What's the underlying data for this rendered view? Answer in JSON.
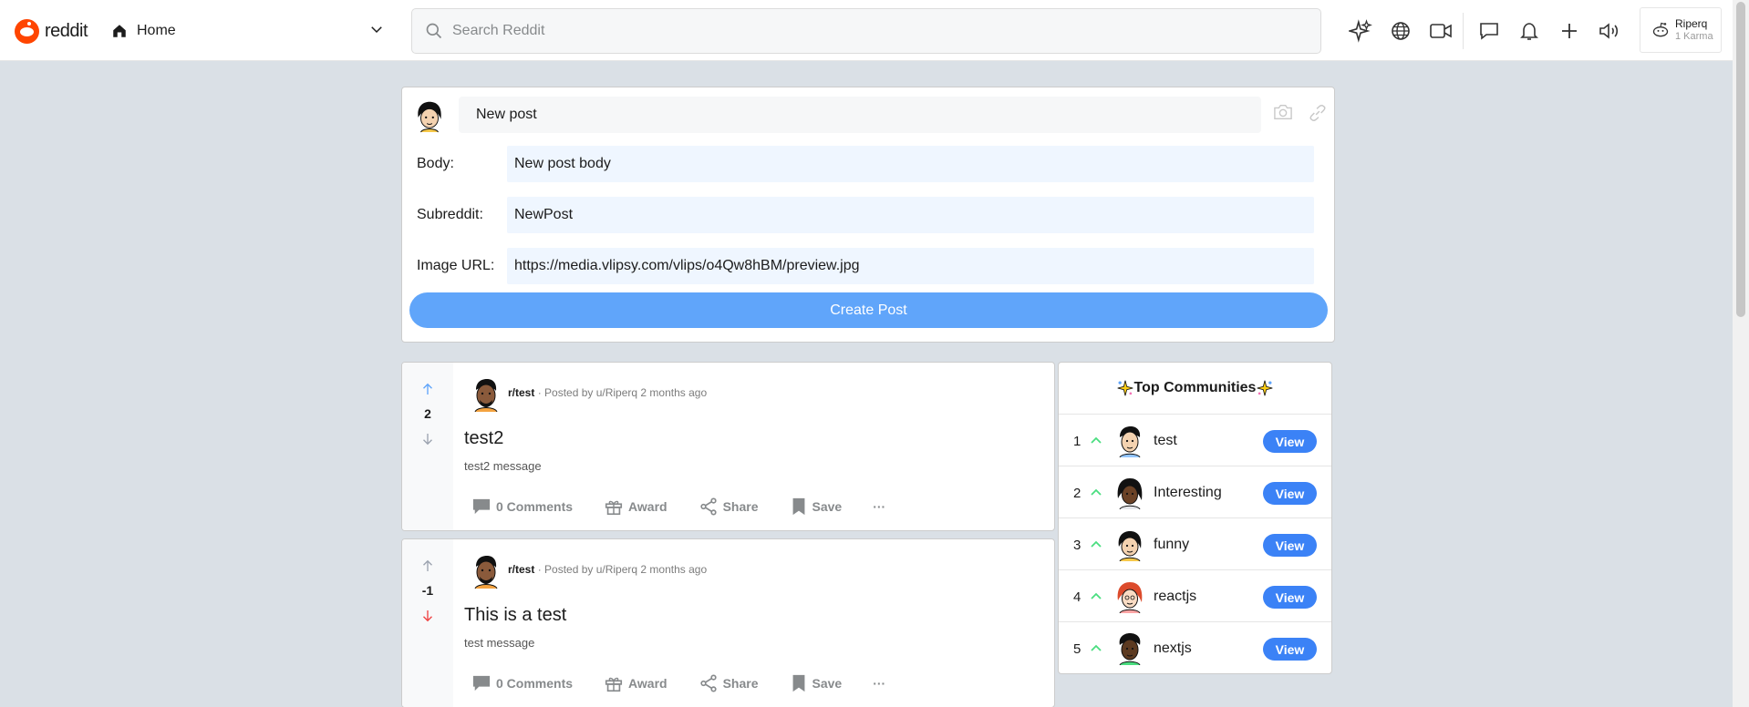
{
  "header": {
    "logo_text": "reddit",
    "home_label": "Home",
    "search_placeholder": "Search Reddit",
    "icons": [
      "sparkle-icon",
      "globe-icon",
      "video-icon",
      "chat-icon",
      "bell-icon",
      "plus-icon",
      "speaker-icon"
    ],
    "user": {
      "name": "Riperq",
      "karma": "1 Karma"
    }
  },
  "create_post": {
    "title_value": "New post",
    "fields": [
      {
        "label": "Body:",
        "value": "New post body"
      },
      {
        "label": "Subreddit:",
        "value": "NewPost"
      },
      {
        "label": "Image URL:",
        "value": "https://media.vlipsy.com/vlips/o4Qw8hBM/preview.jpg"
      }
    ],
    "button_label": "Create Post"
  },
  "posts": [
    {
      "score": "2",
      "vote_state": "up",
      "subreddit": "r/test",
      "meta": "· Posted by u/Riperq 2 months ago",
      "title": "test2",
      "body": "test2 message",
      "comments": "0 Comments",
      "award": "Award",
      "share": "Share",
      "save": "Save",
      "more": "···"
    },
    {
      "score": "-1",
      "vote_state": "down",
      "subreddit": "r/test",
      "meta": "· Posted by u/Riperq 2 months ago",
      "title": "This is a test",
      "body": "test message",
      "comments": "0 Comments",
      "award": "Award",
      "share": "Share",
      "save": "Save",
      "more": "···"
    }
  ],
  "sidebar": {
    "title": "Top Communities",
    "view_label": "View",
    "communities": [
      {
        "rank": "1",
        "name": "test"
      },
      {
        "rank": "2",
        "name": "Interesting"
      },
      {
        "rank": "3",
        "name": "funny"
      },
      {
        "rank": "4",
        "name": "reactjs"
      },
      {
        "rank": "5",
        "name": "nextjs"
      }
    ]
  },
  "colors": {
    "accent": "#3b82f6",
    "button": "#60a5fa",
    "brand": "#ff4500",
    "upvote": "#60a5fa",
    "downvote": "#ef4444",
    "caret": "#4ade80"
  }
}
